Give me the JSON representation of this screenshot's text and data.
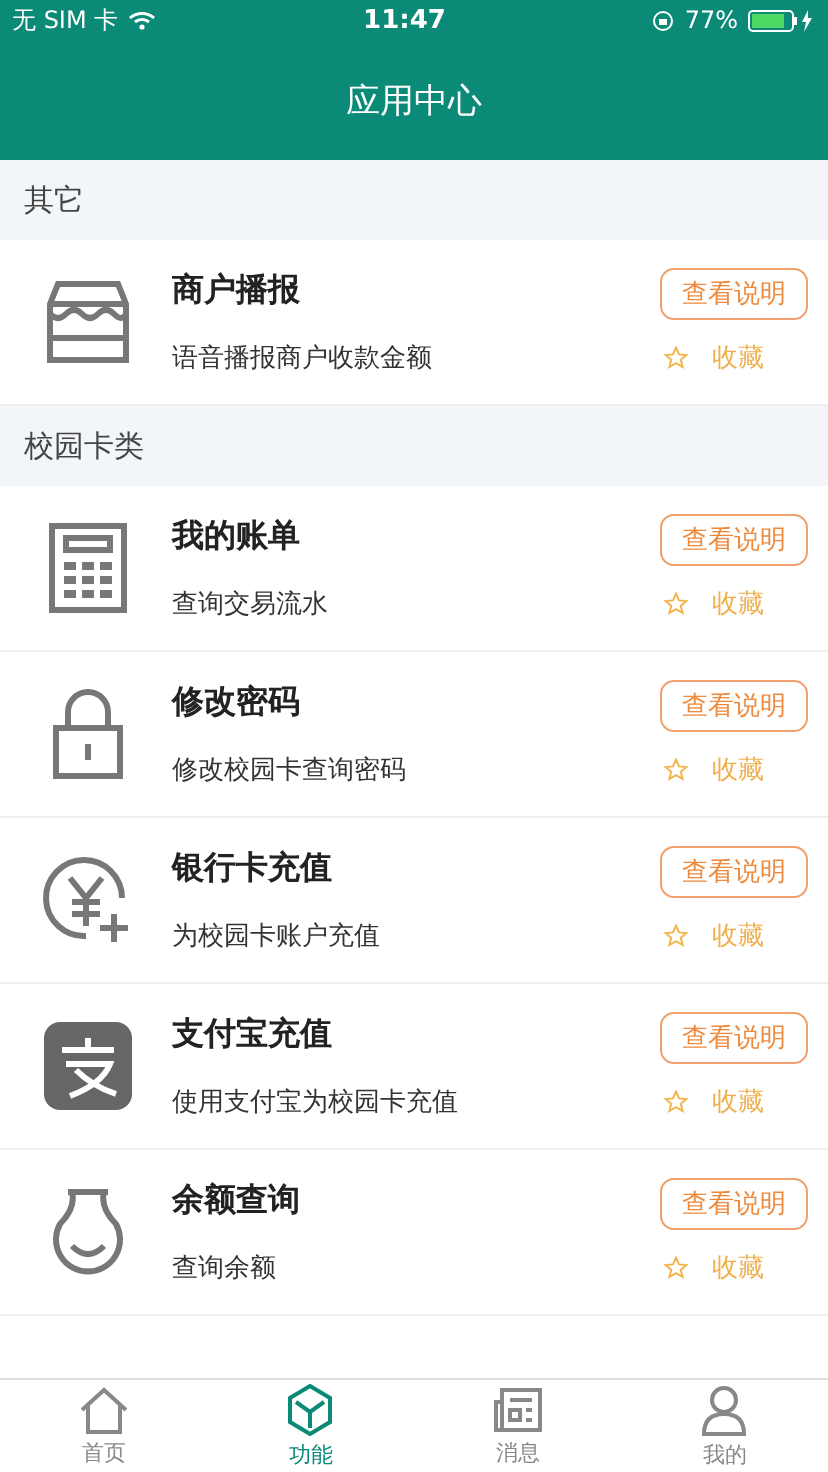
{
  "status_bar": {
    "carrier": "无 SIM 卡",
    "time": "11:47",
    "battery": "77%"
  },
  "header": {
    "title": "应用中心"
  },
  "sections": [
    {
      "title": "其它",
      "items": [
        {
          "name": "商户播报",
          "desc": "语音播报商户收款金额",
          "button": "查看说明",
          "favorite_label": "收藏",
          "favorited": false
        }
      ]
    },
    {
      "title": "校园卡类",
      "items": [
        {
          "name": "我的账单",
          "desc": "查询交易流水",
          "button": "查看说明",
          "favorite_label": "收藏",
          "favorited": false
        },
        {
          "name": "修改密码",
          "desc": "修改校园卡查询密码",
          "button": "查看说明",
          "favorite_label": "收藏",
          "favorited": false
        },
        {
          "name": "银行卡充值",
          "desc": "为校园卡账户充值",
          "button": "查看说明",
          "favorite_label": "收藏",
          "favorited": false
        },
        {
          "name": "支付宝充值",
          "desc": "使用支付宝为校园卡充值",
          "button": "查看说明",
          "favorite_label": "收藏",
          "favorited": false
        },
        {
          "name": "余额查询",
          "desc": "查询余额",
          "button": "查看说明",
          "favorite_label": "收藏",
          "favorited": false
        }
      ]
    }
  ],
  "tab_bar": [
    {
      "label": "首页",
      "selected": false
    },
    {
      "label": "功能",
      "selected": true
    },
    {
      "label": "消息",
      "selected": false
    },
    {
      "label": "我的",
      "selected": false
    }
  ]
}
